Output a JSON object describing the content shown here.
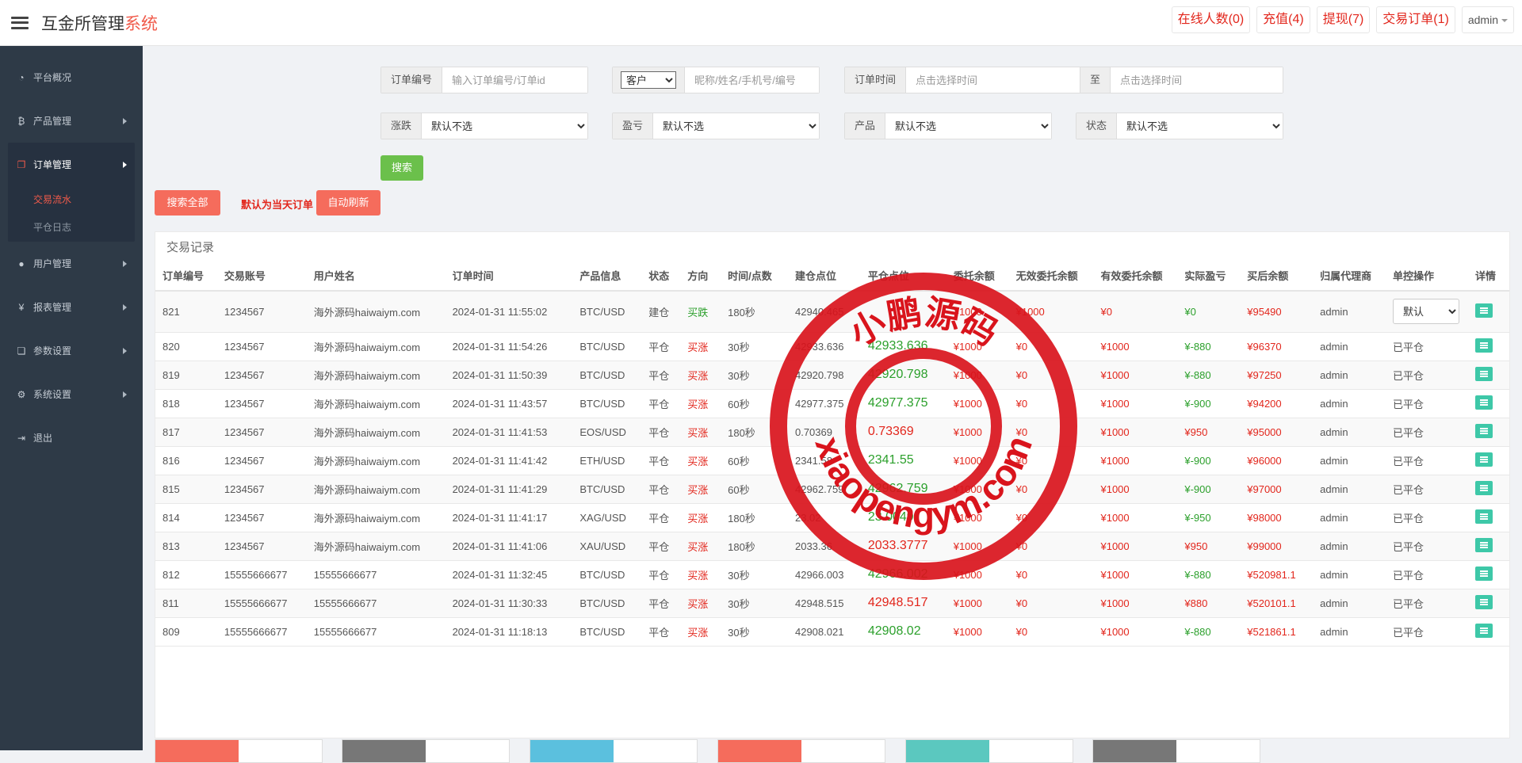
{
  "header": {
    "logo_main": "互金所管理",
    "logo_accent": "系统",
    "buttons": [
      {
        "label": "在线人数(0)"
      },
      {
        "label": "充值(4)"
      },
      {
        "label": "提现(7)"
      },
      {
        "label": "交易订单(1)"
      }
    ],
    "user": "admin"
  },
  "sidebar": {
    "items": [
      {
        "label": "平台概况",
        "icon": "dashboard-icon"
      },
      {
        "label": "产品管理",
        "icon": "bitcoin-icon"
      },
      {
        "label": "订单管理",
        "icon": "copy-icon"
      },
      {
        "label": "用户管理",
        "icon": "user-icon"
      },
      {
        "label": "报表管理",
        "icon": "yen-icon"
      },
      {
        "label": "参数设置",
        "icon": "files-icon"
      },
      {
        "label": "系统设置",
        "icon": "gears-icon"
      },
      {
        "label": "退出",
        "icon": "sign-out-icon"
      }
    ],
    "sub_items": [
      {
        "label": "交易流水"
      },
      {
        "label": "平仓日志"
      }
    ]
  },
  "filters": {
    "order_no_label": "订单编号",
    "order_no_placeholder": "输入订单编号/订单id",
    "customer_select": "客户",
    "customer_placeholder": "昵称/姓名/手机号/编号",
    "time_label": "订单时间",
    "time_placeholder": "点击选择时间",
    "to_label": "至",
    "time2_placeholder": "点击选择时间",
    "rise_fall_label": "涨跌",
    "profit_label": "盈亏",
    "product_label": "产品",
    "status_label": "状态",
    "default_option": "默认不选",
    "search_button": "搜索"
  },
  "actions": {
    "search_all": "搜索全部",
    "note": "默认为当天订单",
    "auto_refresh": "自动刷新"
  },
  "table": {
    "title": "交易记录",
    "columns": [
      "订单编号",
      "交易账号",
      "用户姓名",
      "订单时间",
      "产品信息",
      "状态",
      "方向",
      "时间/点数",
      "建仓点位",
      "平仓点位",
      "委托余额",
      "无效委托余额",
      "有效委托余额",
      "实际盈亏",
      "买后余额",
      "归属代理商",
      "单控操作",
      "详情"
    ],
    "op_select": "默认",
    "rows": [
      {
        "id": "821",
        "account": "1234567",
        "name": "海外源码haiwaiym.com",
        "time": "2024-01-31 11:55:02",
        "product": "BTC/USD",
        "status": "建仓",
        "dir": "买跌",
        "dir_color": "green",
        "period": "180秒",
        "open": "42940.465",
        "close": "",
        "close_color": "green",
        "entrust": "¥1000",
        "invalid": "¥1000",
        "valid": "¥0",
        "pnl": "¥0",
        "pnl_color": "green",
        "after": "¥95490",
        "agent": "admin",
        "op": "select"
      },
      {
        "id": "820",
        "account": "1234567",
        "name": "海外源码haiwaiym.com",
        "time": "2024-01-31 11:54:26",
        "product": "BTC/USD",
        "status": "平仓",
        "dir": "买涨",
        "dir_color": "red",
        "period": "30秒",
        "open": "42933.636",
        "close": "42933.636",
        "close_color": "green",
        "entrust": "¥1000",
        "invalid": "¥0",
        "valid": "¥1000",
        "pnl": "¥-880",
        "pnl_color": "green",
        "after": "¥96370",
        "agent": "admin",
        "op": "已平仓"
      },
      {
        "id": "819",
        "account": "1234567",
        "name": "海外源码haiwaiym.com",
        "time": "2024-01-31 11:50:39",
        "product": "BTC/USD",
        "status": "平仓",
        "dir": "买涨",
        "dir_color": "red",
        "period": "30秒",
        "open": "42920.798",
        "close": "42920.798",
        "close_color": "green",
        "entrust": "¥1000",
        "invalid": "¥0",
        "valid": "¥1000",
        "pnl": "¥-880",
        "pnl_color": "green",
        "after": "¥97250",
        "agent": "admin",
        "op": "已平仓"
      },
      {
        "id": "818",
        "account": "1234567",
        "name": "海外源码haiwaiym.com",
        "time": "2024-01-31 11:43:57",
        "product": "BTC/USD",
        "status": "平仓",
        "dir": "买涨",
        "dir_color": "red",
        "period": "60秒",
        "open": "42977.375",
        "close": "42977.375",
        "close_color": "green",
        "entrust": "¥1000",
        "invalid": "¥0",
        "valid": "¥1000",
        "pnl": "¥-900",
        "pnl_color": "green",
        "after": "¥94200",
        "agent": "admin",
        "op": "已平仓"
      },
      {
        "id": "817",
        "account": "1234567",
        "name": "海外源码haiwaiym.com",
        "time": "2024-01-31 11:41:53",
        "product": "EOS/USD",
        "status": "平仓",
        "dir": "买涨",
        "dir_color": "red",
        "period": "180秒",
        "open": "0.70369",
        "close": "0.73369",
        "close_color": "red",
        "entrust": "¥1000",
        "invalid": "¥0",
        "valid": "¥1000",
        "pnl": "¥950",
        "pnl_color": "red",
        "after": "¥95000",
        "agent": "admin",
        "op": "已平仓"
      },
      {
        "id": "816",
        "account": "1234567",
        "name": "海外源码haiwaiym.com",
        "time": "2024-01-31 11:41:42",
        "product": "ETH/USD",
        "status": "平仓",
        "dir": "买涨",
        "dir_color": "red",
        "period": "60秒",
        "open": "2341.58",
        "close": "2341.55",
        "close_color": "green",
        "entrust": "¥1000",
        "invalid": "¥0",
        "valid": "¥1000",
        "pnl": "¥-900",
        "pnl_color": "green",
        "after": "¥96000",
        "agent": "admin",
        "op": "已平仓"
      },
      {
        "id": "815",
        "account": "1234567",
        "name": "海外源码haiwaiym.com",
        "time": "2024-01-31 11:41:29",
        "product": "BTC/USD",
        "status": "平仓",
        "dir": "买涨",
        "dir_color": "red",
        "period": "60秒",
        "open": "42962.759",
        "close": "42962.759",
        "close_color": "green",
        "entrust": "¥1000",
        "invalid": "¥0",
        "valid": "¥1000",
        "pnl": "¥-900",
        "pnl_color": "green",
        "after": "¥97000",
        "agent": "admin",
        "op": "已平仓"
      },
      {
        "id": "814",
        "account": "1234567",
        "name": "海外源码haiwaiym.com",
        "time": "2024-01-31 11:41:17",
        "product": "XAG/USD",
        "status": "平仓",
        "dir": "买涨",
        "dir_color": "red",
        "period": "180秒",
        "open": "23.02",
        "close": "23.0049",
        "close_color": "green",
        "entrust": "¥1000",
        "invalid": "¥0",
        "valid": "¥1000",
        "pnl": "¥-950",
        "pnl_color": "green",
        "after": "¥98000",
        "agent": "admin",
        "op": "已平仓"
      },
      {
        "id": "813",
        "account": "1234567",
        "name": "海外源码haiwaiym.com",
        "time": "2024-01-31 11:41:06",
        "product": "XAU/USD",
        "status": "平仓",
        "dir": "买涨",
        "dir_color": "red",
        "period": "180秒",
        "open": "2033.36",
        "close": "2033.3777",
        "close_color": "red",
        "entrust": "¥1000",
        "invalid": "¥0",
        "valid": "¥1000",
        "pnl": "¥950",
        "pnl_color": "red",
        "after": "¥99000",
        "agent": "admin",
        "op": "已平仓"
      },
      {
        "id": "812",
        "account": "15555666677",
        "name": "15555666677",
        "time": "2024-01-31 11:32:45",
        "product": "BTC/USD",
        "status": "平仓",
        "dir": "买涨",
        "dir_color": "red",
        "period": "30秒",
        "open": "42966.003",
        "close": "42966.002",
        "close_color": "green",
        "entrust": "¥1000",
        "invalid": "¥0",
        "valid": "¥1000",
        "pnl": "¥-880",
        "pnl_color": "green",
        "after": "¥520981.1",
        "agent": "admin",
        "op": "已平仓"
      },
      {
        "id": "811",
        "account": "15555666677",
        "name": "15555666677",
        "time": "2024-01-31 11:30:33",
        "product": "BTC/USD",
        "status": "平仓",
        "dir": "买涨",
        "dir_color": "red",
        "period": "30秒",
        "open": "42948.515",
        "close": "42948.517",
        "close_color": "red",
        "entrust": "¥1000",
        "invalid": "¥0",
        "valid": "¥1000",
        "pnl": "¥880",
        "pnl_color": "red",
        "after": "¥520101.1",
        "agent": "admin",
        "op": "已平仓"
      },
      {
        "id": "809",
        "account": "15555666677",
        "name": "15555666677",
        "time": "2024-01-31 11:18:13",
        "product": "BTC/USD",
        "status": "平仓",
        "dir": "买涨",
        "dir_color": "red",
        "period": "30秒",
        "open": "42908.021",
        "close": "42908.02",
        "close_color": "green",
        "entrust": "¥1000",
        "invalid": "¥0",
        "valid": "¥1000",
        "pnl": "¥-880",
        "pnl_color": "green",
        "after": "¥521861.1",
        "agent": "admin",
        "op": "已平仓"
      }
    ]
  },
  "stats": [
    {
      "label": "",
      "value": "",
      "color": "#f56c5c"
    },
    {
      "label": "",
      "value": "",
      "color": "#777777"
    },
    {
      "label": "",
      "value": "",
      "color": "#5bc0de"
    },
    {
      "label": "",
      "value": "",
      "color": "#f56c5c"
    },
    {
      "label": "",
      "value": "",
      "color": "#5bc8bf"
    },
    {
      "label": "",
      "value": "",
      "color": "#777777"
    }
  ],
  "watermark": {
    "top_text": "小鹏源码",
    "bottom_text": "xiaopengym.com",
    "color": "#d9141c"
  }
}
